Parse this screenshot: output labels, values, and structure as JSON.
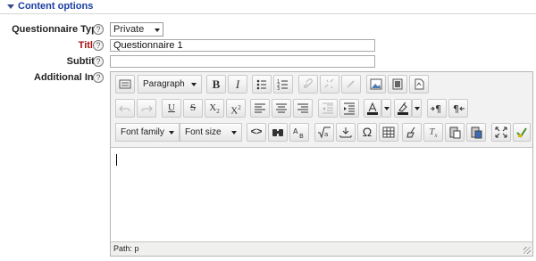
{
  "section": {
    "title": "Content options"
  },
  "fields": {
    "questionnaire_type": {
      "label": "Questionnaire Type",
      "value": "Private"
    },
    "title": {
      "label": "Title",
      "required_mark": "*",
      "value": "Questionnaire 1"
    },
    "subtitle": {
      "label": "Subtitle",
      "value": ""
    },
    "additional_info": {
      "label": "Additional Info"
    }
  },
  "help_icon": "?",
  "editor": {
    "format_select": "Paragraph",
    "font_family_select": "Font family",
    "font_size_select": "Font size",
    "buttons": {
      "bold": "B",
      "italic": "I",
      "underline": "U",
      "strikethrough": "S",
      "subscript": "X2",
      "superscript": "X2",
      "omega": "Ω",
      "clear_format": "Tx"
    },
    "status": "Path: p"
  }
}
